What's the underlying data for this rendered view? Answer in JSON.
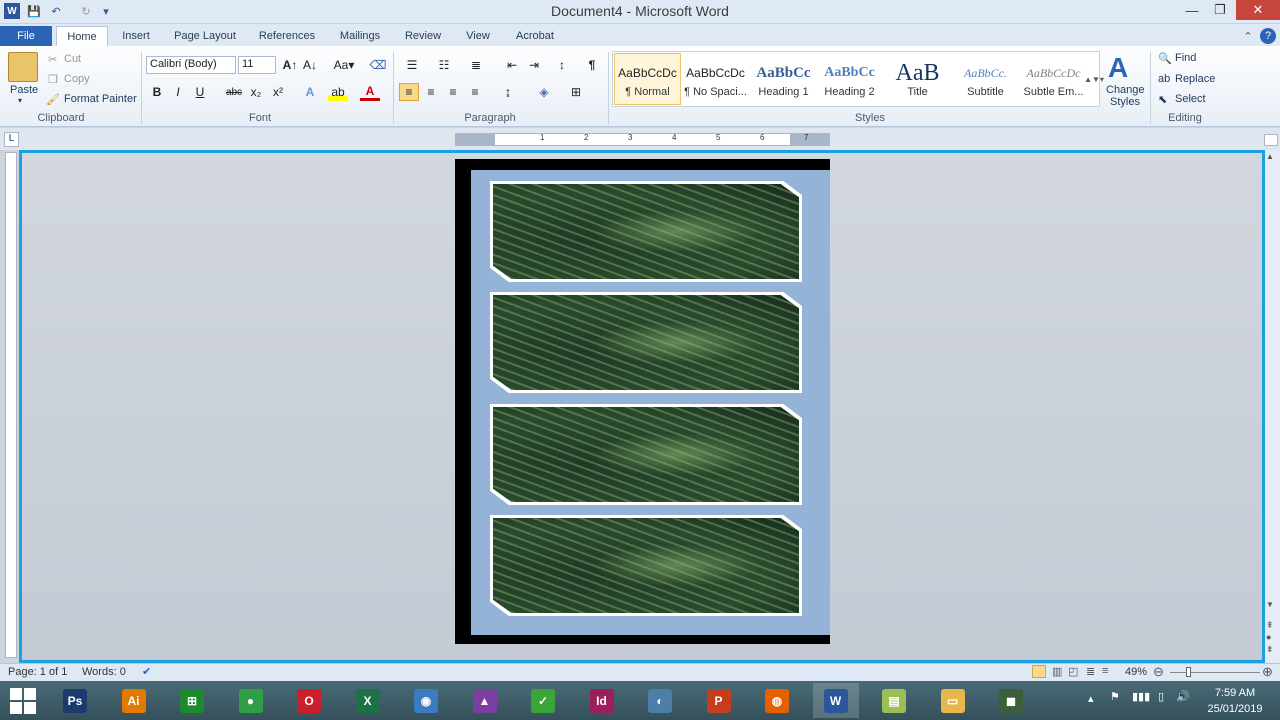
{
  "window": {
    "title": "Document4 - Microsoft Word",
    "minimize": "—",
    "restore": "❐",
    "close": "✕"
  },
  "tabs": [
    "File",
    "Home",
    "Insert",
    "Page Layout",
    "References",
    "Mailings",
    "Review",
    "View",
    "Acrobat"
  ],
  "clipboard": {
    "paste": "Paste",
    "cut": "Cut",
    "copy": "Copy",
    "format_painter": "Format Painter",
    "label": "Clipboard"
  },
  "font": {
    "family": "Calibri (Body)",
    "size": "11",
    "label": "Font",
    "buttons": [
      "B",
      "I",
      "U",
      "abc",
      "x₂",
      "x²"
    ]
  },
  "paragraph": {
    "label": "Paragraph"
  },
  "styles": {
    "label": "Styles",
    "change_styles": "Change Styles",
    "items": [
      {
        "preview": "AaBbCcDc",
        "name": "¶ Normal"
      },
      {
        "preview": "AaBbCcDc",
        "name": "¶ No Spaci..."
      },
      {
        "preview": "AaBbCc",
        "name": "Heading 1"
      },
      {
        "preview": "AaBbCc",
        "name": "Heading 2"
      },
      {
        "preview": "AaB",
        "name": "Title"
      },
      {
        "preview": "AaBbCc.",
        "name": "Subtitle"
      },
      {
        "preview": "AaBbCcDc",
        "name": "Subtle Em..."
      }
    ]
  },
  "editing": {
    "find": "Find",
    "replace": "Replace",
    "select": "Select",
    "label": "Editing"
  },
  "ruler": {
    "numbers": [
      "1",
      "2",
      "3",
      "4",
      "5",
      "6",
      "7"
    ]
  },
  "status": {
    "page": "Page: 1 of 1",
    "words": "Words: 0",
    "zoom": "49%"
  },
  "taskbar": {
    "apps": [
      {
        "name": "photoshop",
        "label": "Ps",
        "color": "#1b3b6f"
      },
      {
        "name": "illustrator",
        "label": "Ai",
        "color": "#e07b00"
      },
      {
        "name": "store",
        "label": "⊞",
        "color": "#1d8a2e"
      },
      {
        "name": "chrome",
        "label": "●",
        "color": "#2f9e44"
      },
      {
        "name": "opera",
        "label": "O",
        "color": "#cc1f2b"
      },
      {
        "name": "excel",
        "label": "X",
        "color": "#1e7145"
      },
      {
        "name": "camera",
        "label": "◉",
        "color": "#3b7bbf"
      },
      {
        "name": "photos",
        "label": "▲",
        "color": "#7a3fa0"
      },
      {
        "name": "greenapp",
        "label": "✓",
        "color": "#3aa63a"
      },
      {
        "name": "indesign",
        "label": "Id",
        "color": "#9c1e5a"
      },
      {
        "name": "chat",
        "label": "◐",
        "color": "#4b7ea8"
      },
      {
        "name": "powerpoint",
        "label": "P",
        "color": "#c43e1c"
      },
      {
        "name": "firefox",
        "label": "◍",
        "color": "#e66000"
      },
      {
        "name": "word",
        "label": "W",
        "color": "#2b579a"
      },
      {
        "name": "notes",
        "label": "▤",
        "color": "#9bbf55"
      },
      {
        "name": "explorer",
        "label": "▭",
        "color": "#e6b84a"
      },
      {
        "name": "camtasia",
        "label": "◼",
        "color": "#3a5f3a"
      }
    ],
    "time": "7:59 AM",
    "date": "25/01/2019"
  }
}
